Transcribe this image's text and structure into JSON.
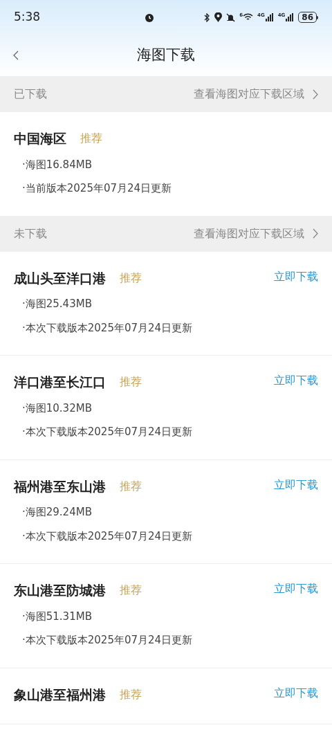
{
  "status_bar": {
    "time": "5:38",
    "wifi_label": "6",
    "signal_labels": [
      "4G",
      "4G"
    ],
    "battery": "86"
  },
  "nav": {
    "title": "海图下载"
  },
  "sections": [
    {
      "title": "已下载",
      "link": "查看海图对应下载区域",
      "items": [
        {
          "name": "中国海区",
          "tag": "推荐",
          "size": "·海图16.84MB",
          "version": "·当前版本2025年07月24日更新"
        }
      ]
    },
    {
      "title": "未下载",
      "link": "查看海图对应下载区域",
      "items": [
        {
          "name": "成山头至洋口港",
          "tag": "推荐",
          "size": "·海图25.43MB",
          "version": "·本次下载版本2025年07月24日更新",
          "action": "立即下载"
        },
        {
          "name": "洋口港至长江口",
          "tag": "推荐",
          "size": "·海图10.32MB",
          "version": "·本次下载版本2025年07月24日更新",
          "action": "立即下载"
        },
        {
          "name": "福州港至东山港",
          "tag": "推荐",
          "size": "·海图29.24MB",
          "version": "·本次下载版本2025年07月24日更新",
          "action": "立即下载"
        },
        {
          "name": "东山港至防城港",
          "tag": "推荐",
          "size": "·海图51.31MB",
          "version": "·本次下载版本2025年07月24日更新",
          "action": "立即下载"
        },
        {
          "name": "象山港至福州港",
          "tag": "推荐",
          "action": "立即下载"
        }
      ]
    }
  ]
}
